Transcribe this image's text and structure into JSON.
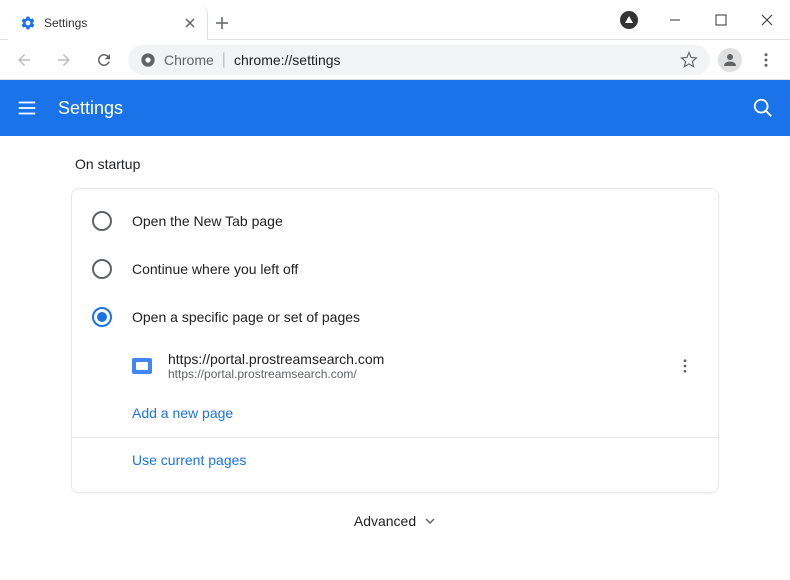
{
  "window": {
    "tab_title": "Settings"
  },
  "address_bar": {
    "prefix": "Chrome",
    "url": "chrome://settings"
  },
  "header": {
    "title": "Settings"
  },
  "section": {
    "title": "On startup",
    "options": [
      {
        "label": "Open the New Tab page",
        "selected": false
      },
      {
        "label": "Continue where you left off",
        "selected": false
      },
      {
        "label": "Open a specific page or set of pages",
        "selected": true
      }
    ],
    "pages": [
      {
        "title": "https://portal.prostreamsearch.com",
        "url": "https://portal.prostreamsearch.com/"
      }
    ],
    "add_page": "Add a new page",
    "use_current": "Use current pages"
  },
  "advanced": "Advanced"
}
